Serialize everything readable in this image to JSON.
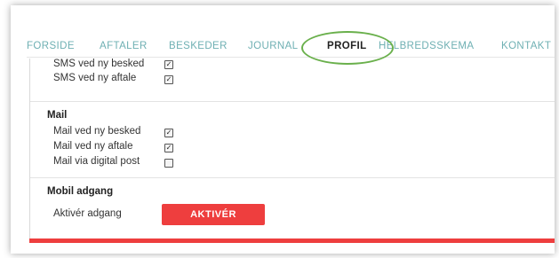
{
  "nav": {
    "tabs": [
      {
        "label": "FORSIDE"
      },
      {
        "label": "AFTALER"
      },
      {
        "label": "BESKEDER"
      },
      {
        "label": "JOURNAL"
      },
      {
        "label": "PROFIL"
      },
      {
        "label": "HELBREDSSKEMA"
      },
      {
        "label": "KONTAKT"
      }
    ],
    "active_tab": "PROFIL"
  },
  "sms_section": {
    "items": [
      {
        "label": "SMS ved ny besked",
        "checked": true
      },
      {
        "label": "SMS ved ny aftale",
        "checked": true
      }
    ]
  },
  "mail_section": {
    "heading": "Mail",
    "items": [
      {
        "label": "Mail ved ny besked",
        "checked": true
      },
      {
        "label": "Mail ved ny aftale",
        "checked": true
      },
      {
        "label": "Mail via digital post",
        "checked": false
      }
    ]
  },
  "mobile_section": {
    "heading": "Mobil adgang",
    "label": "Aktivér adgang",
    "button_label": "AKTIVÉR"
  },
  "colors": {
    "accent_red": "#ee3e3e",
    "tab_teal": "#6fb0b3",
    "highlight_green": "#6ab04c"
  }
}
